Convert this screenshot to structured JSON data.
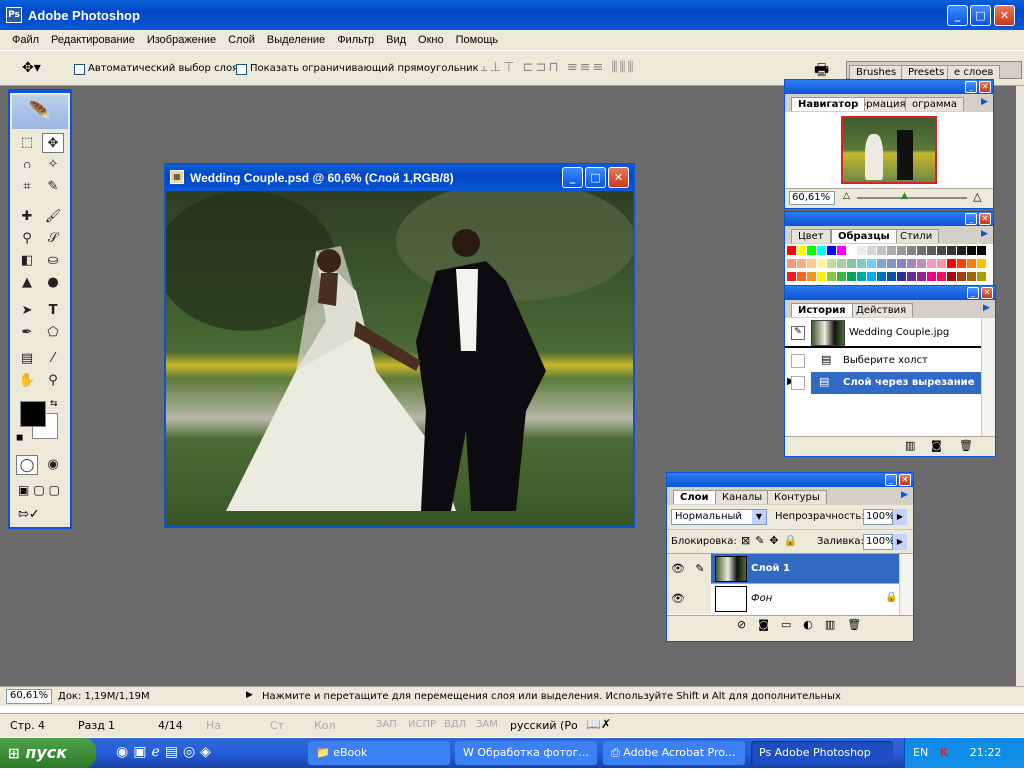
{
  "app": {
    "title": "Adobe Photoshop"
  },
  "menu": [
    "Файл",
    "Редактирование",
    "Изображение",
    "Слой",
    "Выделение",
    "Фильтр",
    "Вид",
    "Окно",
    "Помощь"
  ],
  "options": {
    "auto_select": "Автоматический выбор слоя",
    "show_bounds": "Показать ограничивающий прямоугольник",
    "well_tabs": [
      "Brushes",
      "Presets",
      "е слоев"
    ]
  },
  "document": {
    "title": "Wedding Couple.psd @ 60,6% (Слой 1,RGB/8)"
  },
  "navigator": {
    "tabs": [
      "Навигатор",
      "ормация",
      "ограмма"
    ],
    "zoom": "60,61%"
  },
  "swatches": {
    "tabs": [
      "Цвет",
      "Образцы",
      "Стили"
    ],
    "colors": [
      "#ff0000",
      "#ffff00",
      "#00ff00",
      "#00ffff",
      "#0000ff",
      "#ff00ff",
      "#ffffff",
      "#ebebeb",
      "#d6d6d6",
      "#c2c2c2",
      "#adadad",
      "#999999",
      "#858585",
      "#707070",
      "#5c5c5c",
      "#474747",
      "#333333",
      "#1f1f1f",
      "#0a0a0a",
      "#000000",
      "#f7977a",
      "#f9ad81",
      "#fdc68a",
      "#fff79a",
      "#c4df9b",
      "#a3d39c",
      "#82ca9d",
      "#7bcdc8",
      "#6ecff6",
      "#7ea7d8",
      "#8493ca",
      "#8882be",
      "#a187be",
      "#bc8dbf",
      "#f49ac2",
      "#f6989d",
      "#ff0000",
      "#ff4000",
      "#ff8000",
      "#ffc000",
      "#ed1c24",
      "#f26522",
      "#f7941d",
      "#fff200",
      "#8dc63f",
      "#39b54a",
      "#00a651",
      "#00a99d",
      "#00aeef",
      "#0072bc",
      "#0054a6",
      "#2e3192",
      "#662d91",
      "#92278f",
      "#ec008c",
      "#ed145b",
      "#9e0b0f",
      "#a0410d",
      "#a36209",
      "#aba000"
    ]
  },
  "history": {
    "tabs": [
      "История",
      "Действия"
    ],
    "snapshot": "Wedding Couple.jpg",
    "items": [
      "Выберите холст",
      "Слой через вырезание"
    ]
  },
  "layers": {
    "tabs": [
      "Слои",
      "Каналы",
      "Контуры"
    ],
    "blend": "Нормальный",
    "opacity_label": "Непрозрачность:",
    "opacity": "100%",
    "lock_label": "Блокировка:",
    "fill_label": "Заливка:",
    "fill": "100%",
    "items": [
      "Слой 1",
      "Фон"
    ]
  },
  "status": {
    "zoom": "60,61%",
    "doc": "Док: 1,19M/1,19M",
    "hint": "Нажмите и перетащите для перемещения слоя или выделения. Используйте Shift и Alt для дополнительных"
  },
  "word_status": {
    "page": "Стр.",
    "page_val": "4",
    "section": "Разд",
    "section_val": "1",
    "pages": "4/14",
    "at": "На",
    "ln": "Ст",
    "col": "Кол",
    "rec": "ЗАП",
    "trk": "ИСПР",
    "ext": "ВДЛ",
    "ovr": "ЗАМ",
    "lang": "русский (Ро"
  },
  "taskbar": {
    "start": "пуск",
    "items": [
      "eBook",
      "Обработка фотог...",
      "Adobe Acrobat Pro...",
      "Adobe Photoshop"
    ],
    "lang": "EN",
    "time": "21:22"
  },
  "colors": {
    "workspace": "#6b6b6b",
    "xp_blue": "#0a58d6",
    "panel": "#ece9d8",
    "highlight": "#316ac5"
  }
}
